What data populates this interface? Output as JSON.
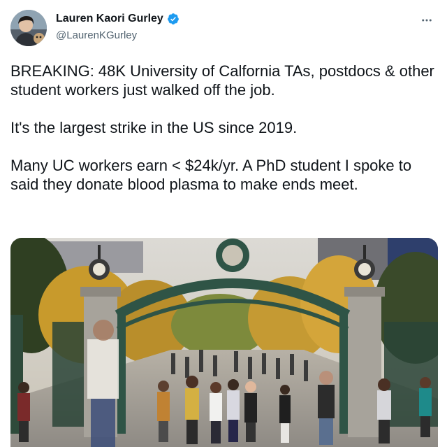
{
  "author": {
    "display_name": "Lauren Kaori Gurley",
    "handle": "@LaurenKGurley",
    "verified": true,
    "avatar_icon": "profile-photo",
    "verified_icon": "verified-badge-icon"
  },
  "tweet": {
    "lines": [
      "BREAKING: 48K University of Calfornia TAs, postdocs & other student workers just walked off the job.",
      "It's the largest strike in the US since 2019.",
      "Many UC workers earn < $24k/yr. A PhD student I spoke to said they donate blood plasma to make ends meet."
    ]
  },
  "media": {
    "image_icon": "campus-gate-photo"
  },
  "colors": {
    "verified_blue": "#1d9bf0",
    "handle_gray": "#536471",
    "text": "#0f1419"
  }
}
